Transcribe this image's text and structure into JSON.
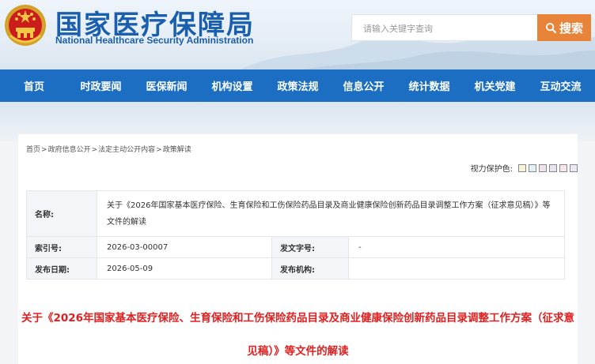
{
  "header": {
    "title_cn": "国家医疗保障局",
    "title_en": "National Healthcare Security Administration",
    "search_placeholder": "请输入关键字查询",
    "search_button": "搜索"
  },
  "nav": {
    "items": [
      "首页",
      "时政要闻",
      "医保新闻",
      "机构设置",
      "政策法规",
      "信息公开",
      "统计数据",
      "机关党建",
      "互动交流"
    ]
  },
  "breadcrumb": [
    "首页",
    "政府信息公开",
    "法定主动公开内容",
    "政策解读"
  ],
  "breadcrumb_sep": ">",
  "vision": {
    "label": "视力保护色:",
    "swatches": [
      "#f5f3d8",
      "#dff1f5",
      "#efe2ee",
      "#e8e2f2",
      "#f5e6ee",
      "#ece6f6"
    ]
  },
  "meta": {
    "name_label": "名称:",
    "name_value": "关于《2026年国家基本医疗保险、生育保险和工伤保险药品目录及商业健康保险创新药品目录调整工作方案（征求意见稿）》等文件的解读",
    "index_label": "索引号:",
    "index_value": "2026-03-00007",
    "issuer_label": "发文字号:",
    "issuer_value": "-",
    "date_label": "发布日期:",
    "date_value": "2026-05-09",
    "org_label": "发布机构:",
    "org_value": ""
  },
  "article": {
    "title": "关于《2026年国家基本医疗保险、生育保险和工伤保险药品目录及商业健康保险创新药品目录调整工作方案（征求意见稿）》等文件的解读"
  }
}
